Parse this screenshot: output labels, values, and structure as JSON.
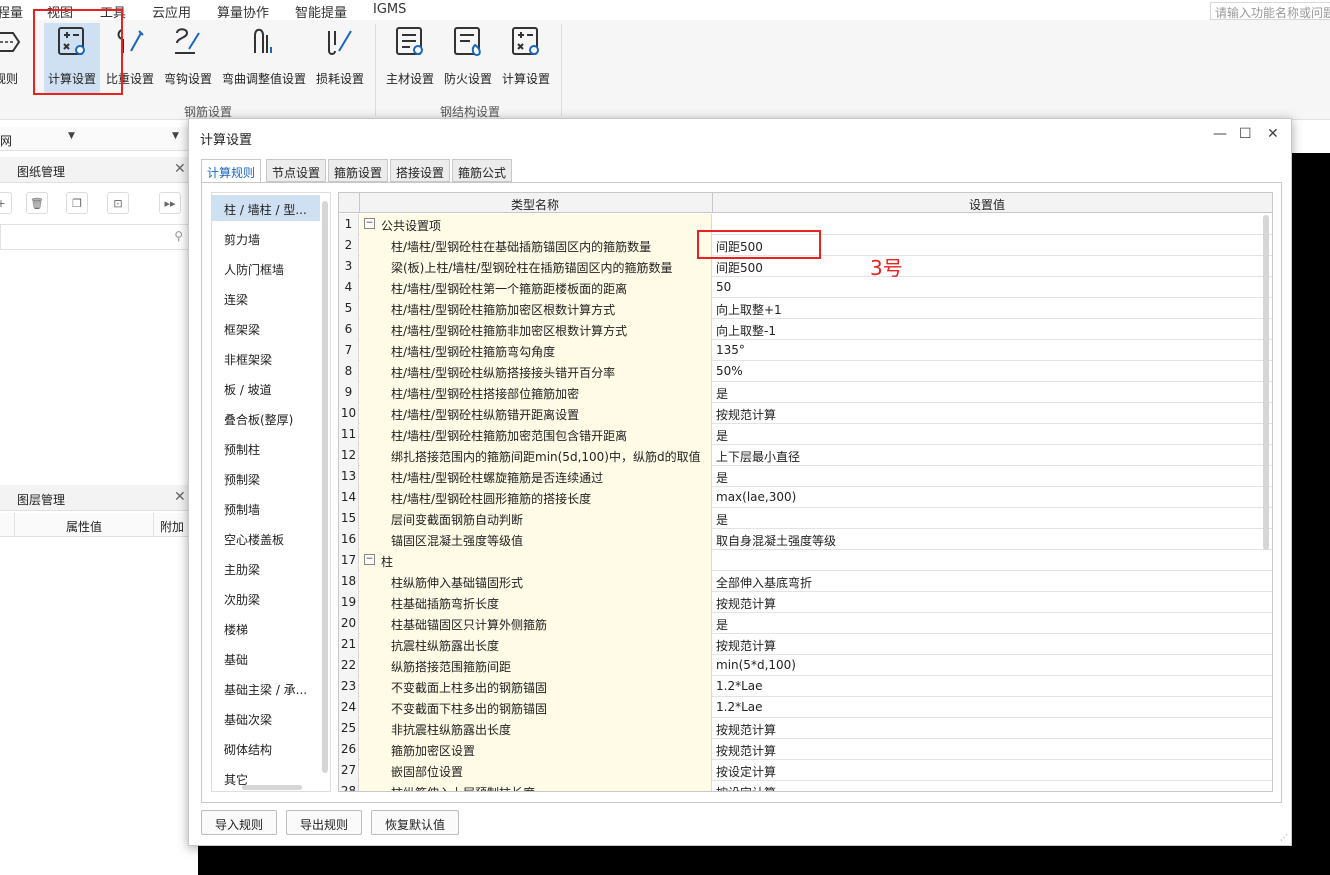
{
  "menu": {
    "items": [
      "程量",
      "视图",
      "工具",
      "云应用",
      "算量协作",
      "智能提量",
      "IGMS"
    ],
    "search_placeholder": "请输入功能名称或问题"
  },
  "ribbon": {
    "left_partial_label": "规则",
    "rebar_group": {
      "label": "钢筋设置",
      "buttons": [
        "计算设置",
        "比重设置",
        "弯钩设置",
        "弯曲调整值设置",
        "损耗设置"
      ]
    },
    "steel_group": {
      "label": "钢结构设置",
      "buttons": [
        "主材设置",
        "防火设置",
        "计算设置"
      ]
    }
  },
  "left_panels": {
    "combo_text": "网",
    "drawing_panel_title": "图纸管理",
    "layer_panel_title": "图层管理",
    "prop_columns": [
      "属性值",
      "附加"
    ]
  },
  "dialog": {
    "title": "计算设置",
    "controls": {
      "minimize": "—",
      "maximize": "☐",
      "close": "✕"
    },
    "tabs": [
      "计算规则",
      "节点设置",
      "箍筋设置",
      "搭接设置",
      "箍筋公式"
    ],
    "active_tab": "计算规则",
    "categories": [
      "柱 / 墙柱 / 型...",
      "剪力墙",
      "人防门框墙",
      "连梁",
      "框架梁",
      "非框架梁",
      "板 / 坡道",
      "叠合板(整厚)",
      "预制柱",
      "预制梁",
      "预制墙",
      "空心楼盖板",
      "主肋梁",
      "次肋梁",
      "楼梯",
      "基础",
      "基础主梁 / 承...",
      "基础次梁",
      "砌体结构",
      "其它"
    ],
    "selected_category": "柱 / 墙柱 / 型...",
    "grid": {
      "col_name": "类型名称",
      "col_value": "设置值",
      "rows": [
        {
          "num": "1",
          "name": "公共设置项",
          "value": "",
          "group": true
        },
        {
          "num": "2",
          "name": "柱/墙柱/型钢砼柱在基础插筋锚固区内的箍筋数量",
          "value": "间距500"
        },
        {
          "num": "3",
          "name": "梁(板)上柱/墙柱/型钢砼柱在插筋锚固区内的箍筋数量",
          "value": "间距500"
        },
        {
          "num": "4",
          "name": "柱/墙柱/型钢砼柱第一个箍筋距楼板面的距离",
          "value": "50"
        },
        {
          "num": "5",
          "name": "柱/墙柱/型钢砼柱箍筋加密区根数计算方式",
          "value": "向上取整+1"
        },
        {
          "num": "6",
          "name": "柱/墙柱/型钢砼柱箍筋非加密区根数计算方式",
          "value": "向上取整-1"
        },
        {
          "num": "7",
          "name": "柱/墙柱/型钢砼柱箍筋弯勾角度",
          "value": "135°"
        },
        {
          "num": "8",
          "name": "柱/墙柱/型钢砼柱纵筋搭接接头错开百分率",
          "value": "50%"
        },
        {
          "num": "9",
          "name": "柱/墙柱/型钢砼柱搭接部位箍筋加密",
          "value": "是"
        },
        {
          "num": "10",
          "name": "柱/墙柱/型钢砼柱纵筋错开距离设置",
          "value": "按规范计算"
        },
        {
          "num": "11",
          "name": "柱/墙柱/型钢砼柱箍筋加密范围包含错开距离",
          "value": "是"
        },
        {
          "num": "12",
          "name": "绑扎搭接范围内的箍筋间距min(5d,100)中，纵筋d的取值",
          "value": "上下层最小直径"
        },
        {
          "num": "13",
          "name": "柱/墙柱/型钢砼柱螺旋箍筋是否连续通过",
          "value": "是"
        },
        {
          "num": "14",
          "name": "柱/墙柱/型钢砼柱圆形箍筋的搭接长度",
          "value": "max(lae,300)"
        },
        {
          "num": "15",
          "name": "层间变截面钢筋自动判断",
          "value": "是"
        },
        {
          "num": "16",
          "name": "锚固区混凝土强度等级值",
          "value": "取自身混凝土强度等级"
        },
        {
          "num": "17",
          "name": "柱",
          "value": "",
          "group": true
        },
        {
          "num": "18",
          "name": "柱纵筋伸入基础锚固形式",
          "value": "全部伸入基底弯折"
        },
        {
          "num": "19",
          "name": "柱基础插筋弯折长度",
          "value": "按规范计算"
        },
        {
          "num": "20",
          "name": "柱基础锚固区只计算外侧箍筋",
          "value": "是"
        },
        {
          "num": "21",
          "name": "抗震柱纵筋露出长度",
          "value": "按规范计算"
        },
        {
          "num": "22",
          "name": "纵筋搭接范围箍筋间距",
          "value": "min(5*d,100)"
        },
        {
          "num": "23",
          "name": "不变截面上柱多出的钢筋锚固",
          "value": "1.2*Lae"
        },
        {
          "num": "24",
          "name": "不变截面下柱多出的钢筋锚固",
          "value": "1.2*Lae"
        },
        {
          "num": "25",
          "name": "非抗震柱纵筋露出长度",
          "value": "按规范计算"
        },
        {
          "num": "26",
          "name": "箍筋加密区设置",
          "value": "按规范计算"
        },
        {
          "num": "27",
          "name": "嵌固部位设置",
          "value": "按设定计算"
        },
        {
          "num": "28",
          "name": "柱纵筋伸入上层预制柱长度",
          "value": "按设定计算"
        }
      ]
    },
    "footer_buttons": [
      "导入规则",
      "导出规则",
      "恢复默认值"
    ]
  },
  "annotation": {
    "label": "3号",
    "color": "#e8231f"
  },
  "colors": {
    "accent": "#1a66c2",
    "selection": "#cfe0f3",
    "name_cell_bg": "#fffbe6",
    "annotation": "#e8231f"
  }
}
